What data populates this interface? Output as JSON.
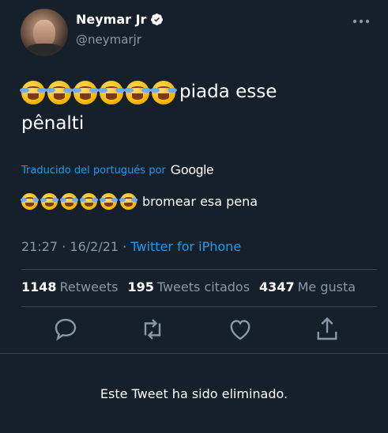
{
  "author": {
    "name": "Neymar Jr",
    "handle": "@neymarjr"
  },
  "tweet": {
    "original_emoji_count": 6,
    "original_text_line1": "piada esse",
    "original_text_line2": "pênalti",
    "translated_label": "Traducido del portugués por",
    "translated_brand": "Google",
    "translated_emoji_count": 6,
    "translated_text": "bromear esa pena",
    "time": "21:27",
    "separator": "·",
    "date": "16/2/21",
    "source": "Twitter for iPhone"
  },
  "stats": {
    "retweets_count": "1148",
    "retweets_label": "Retweets",
    "quotes_count": "195",
    "quotes_label": "Tweets citados",
    "likes_count": "4347",
    "likes_label": "Me gusta"
  },
  "deleted_notice": "Este Tweet ha sido eliminado.",
  "colors": {
    "background": "#15202b",
    "accent": "#1d9bf0",
    "secondary_text": "#8899a6",
    "divider": "#38444d"
  },
  "icons": [
    "verified-badge-icon",
    "more-icon",
    "reply-icon",
    "retweet-icon",
    "like-icon",
    "share-icon"
  ]
}
